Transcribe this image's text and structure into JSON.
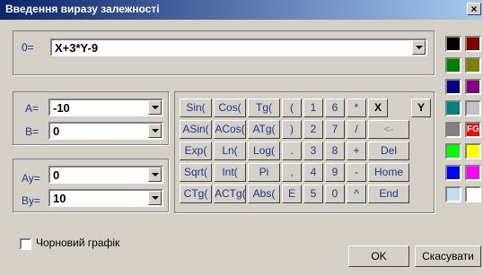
{
  "window": {
    "title": "Введення виразу залежності",
    "close": "×"
  },
  "expr": {
    "label": "0=",
    "value": "X+3*Y-9"
  },
  "params": {
    "a": {
      "label": "A=",
      "value": "-10"
    },
    "b": {
      "label": "B=",
      "value": "0"
    },
    "ay": {
      "label": "Ay=",
      "value": "0"
    },
    "by": {
      "label": "By=",
      "value": "10"
    }
  },
  "keypad": {
    "rows": [
      [
        "Sin(",
        "Cos(",
        "Tg(",
        "(",
        "1",
        "6",
        "*",
        "X",
        "Y"
      ],
      [
        "ASin(",
        "ACos(",
        "ATg(",
        ")",
        "2",
        "7",
        "/",
        "<-"
      ],
      [
        "Exp(",
        "Ln(",
        "Log(",
        ".",
        "3",
        "8",
        "+",
        "Del"
      ],
      [
        "Sqrt(",
        "Int(",
        "Pi",
        ",",
        "4",
        "9",
        "-",
        "Home"
      ],
      [
        "CTg(",
        "ACTg(",
        "Abs(",
        "E",
        "5",
        "0",
        "^",
        "End"
      ]
    ]
  },
  "palette": {
    "colors": [
      "#000000",
      "#800000",
      "#008000",
      "#808000",
      "#000080",
      "#800080",
      "#008080",
      "#c0c0c0",
      "#808080",
      "#ff0000",
      "#00ff00",
      "#ffff00",
      "#0000ff",
      "#ff00ff",
      "#c0e0f0",
      "#ffffff"
    ],
    "label_fg": "FG"
  },
  "draft": {
    "label": "Чорновий графік"
  },
  "buttons": {
    "ok": "OK",
    "cancel": "Скасувати"
  }
}
